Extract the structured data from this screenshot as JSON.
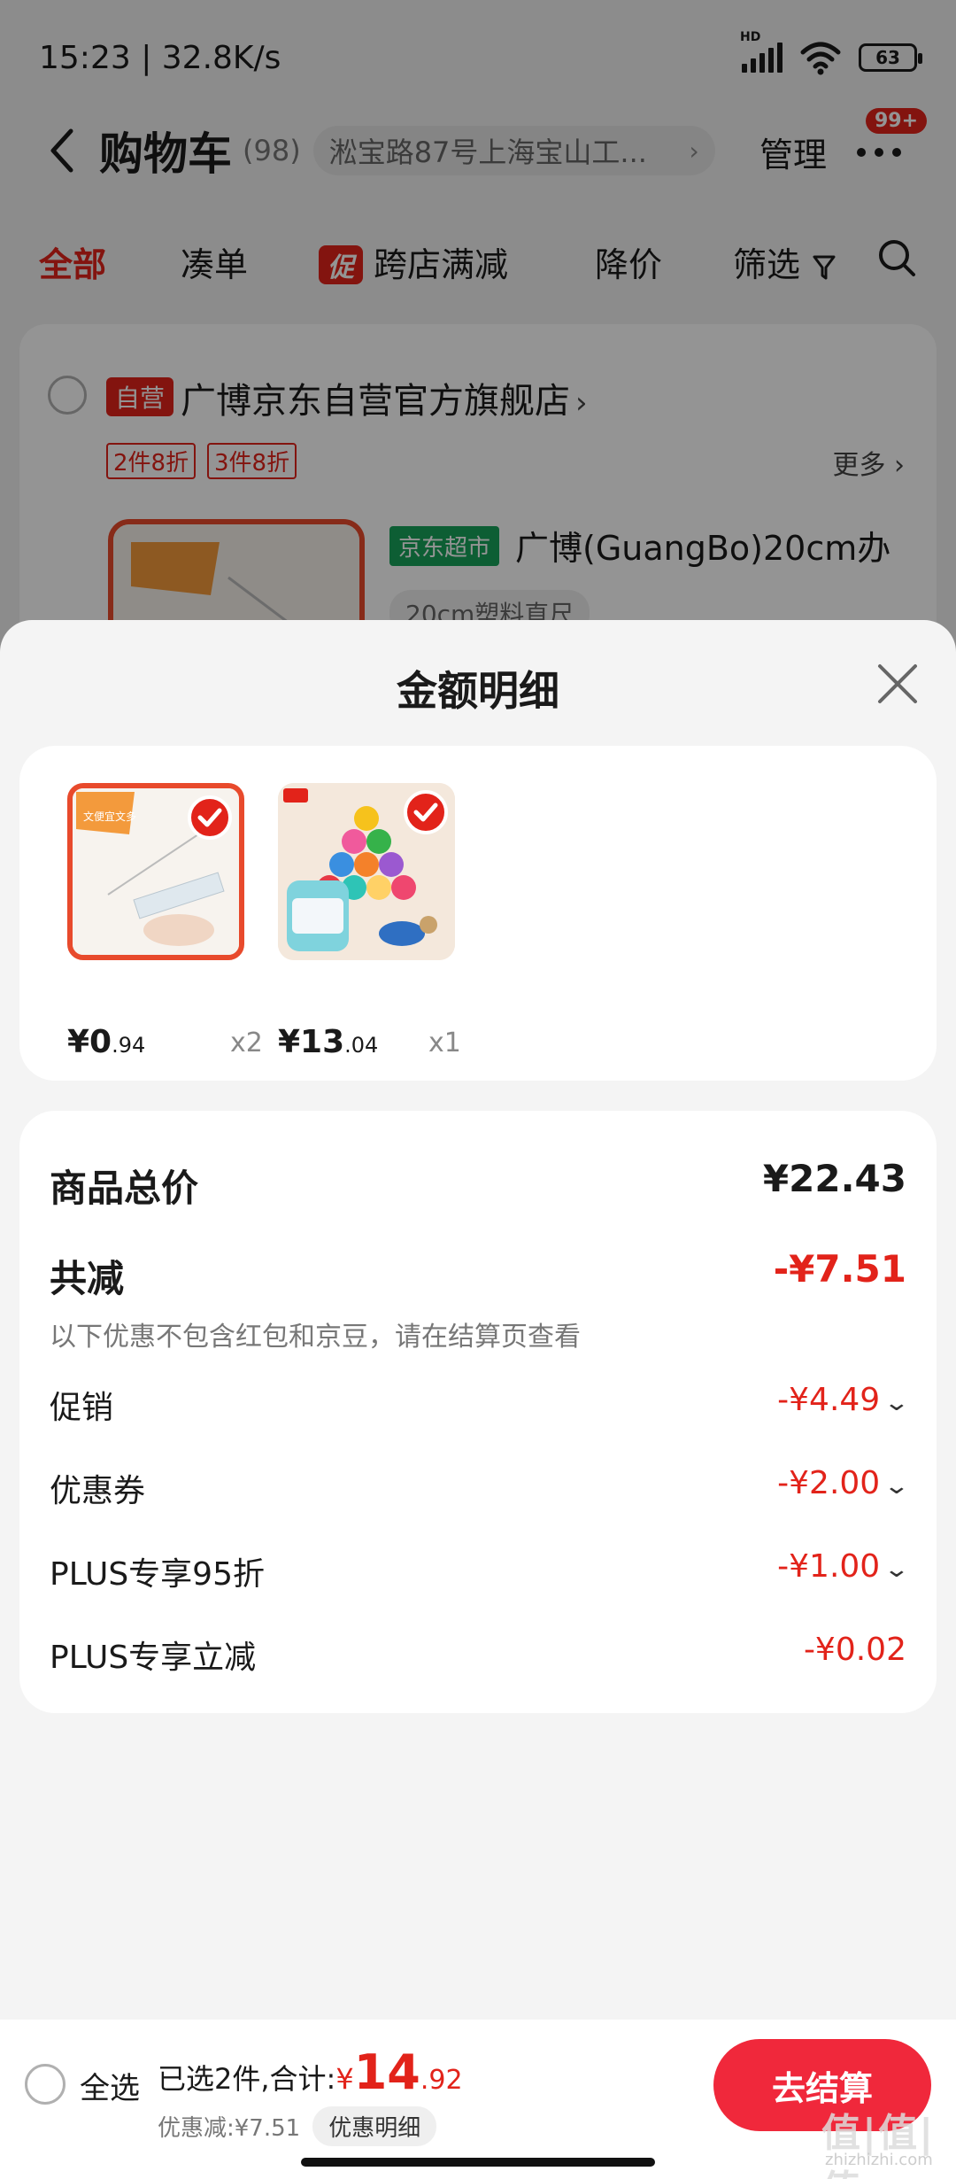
{
  "status_bar": {
    "time": "15:23 | 32.8K/s",
    "network": "HD",
    "battery": "63"
  },
  "nav": {
    "title": "购物车",
    "count": "(98)",
    "address": "淞宝路87号上海宝山工...",
    "manage": "管理",
    "badge": "99+"
  },
  "tabs": [
    {
      "label": "全部",
      "active": true
    },
    {
      "label": "凑单"
    },
    {
      "label": "跨店满减",
      "tag": "促"
    },
    {
      "label": "降价"
    },
    {
      "label": "筛选"
    }
  ],
  "store": {
    "self_tag": "自营",
    "name": "广博京东自营官方旗舰店",
    "promos": [
      "2件8折",
      "3件8折"
    ],
    "more": "更多",
    "supermarket_tag": "京东超市",
    "product_name": "广博(GuangBo)20cm办",
    "spec": "20cm塑料直尺"
  },
  "sheet": {
    "title": "金额明细",
    "items": [
      {
        "price_int": "¥0",
        "price_dec": ".94",
        "qty": "x2"
      },
      {
        "price_int": "¥13",
        "price_dec": ".04",
        "qty": "x1"
      }
    ],
    "total_label": "商品总价",
    "total_value": "¥22.43",
    "reduce_label": "共减",
    "reduce_value": "-¥7.51",
    "reduce_note": "以下优惠不包含红包和京豆，请在结算页查看",
    "lines": [
      {
        "label": "促销",
        "value": "-¥4.49",
        "expandable": true
      },
      {
        "label": "优惠券",
        "value": "-¥2.00",
        "expandable": true
      },
      {
        "label": "PLUS专享95折",
        "value": "-¥1.00",
        "expandable": true
      },
      {
        "label": "PLUS专享立减",
        "value": "-¥0.02",
        "expandable": false
      }
    ]
  },
  "checkout": {
    "select_all": "全选",
    "summary_prefix": "已选2件,合计:",
    "total_yen": "¥",
    "total_int": "14",
    "total_dec": ".92",
    "discount": "优惠减:¥7.51",
    "detail_button": "优惠明细",
    "pay_button": "去结算"
  },
  "watermark": {
    "main": "值|值|值",
    "sub": "zhizhizhi.com"
  },
  "colors": {
    "accent": "#e2231a",
    "pay_button": "#f0283b",
    "supermarket": "#17a35a"
  }
}
